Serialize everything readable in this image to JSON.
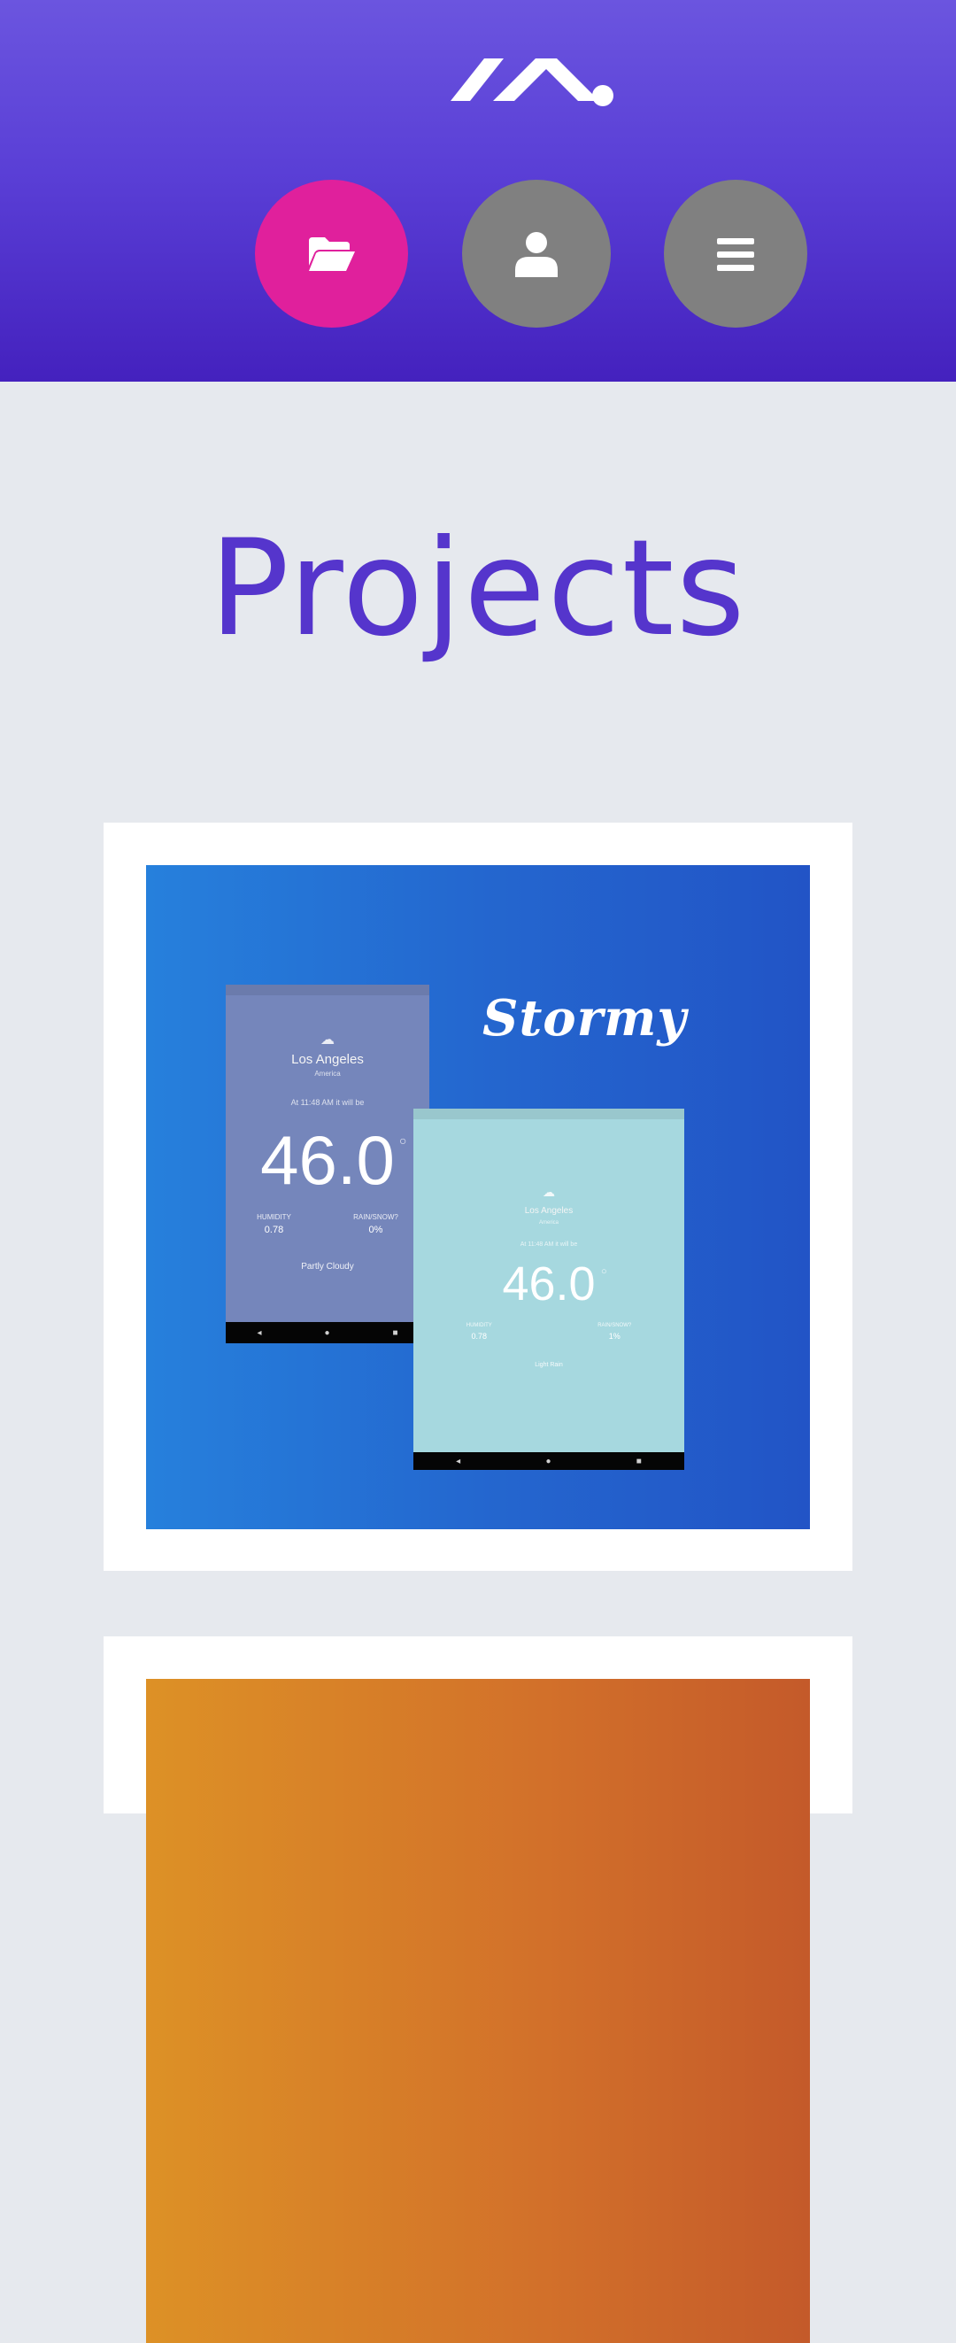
{
  "header": {
    "logo_icon": "logo-mark",
    "nav": [
      {
        "name": "projects",
        "icon": "folder-open-icon",
        "active": true
      },
      {
        "name": "about",
        "icon": "user-icon",
        "active": false
      },
      {
        "name": "menu",
        "icon": "hamburger-menu-icon",
        "active": false
      }
    ],
    "colors": {
      "gradient_top": "#6b55df",
      "gradient_bottom": "#4421be",
      "active": "#e0209c",
      "inactive": "#808080"
    }
  },
  "main": {
    "title": "Projects",
    "title_color": "#5535cc",
    "projects": [
      {
        "brand": "Stormy",
        "phone_a": {
          "city": "Los Angeles",
          "region": "America",
          "time_text": "At 11:48 AM it will be",
          "temperature": "46.0",
          "humidity_label": "HUMIDITY",
          "humidity_value": "0.78",
          "precip_label": "RAIN/SNOW?",
          "precip_value": "0%",
          "summary": "Partly Cloudy"
        },
        "phone_b": {
          "city": "Los Angeles",
          "region": "America",
          "time_text": "At 11:48 AM it will be",
          "temperature": "46.0",
          "humidity_label": "HUMIDITY",
          "humidity_value": "0.78",
          "precip_label": "RAIN/SNOW?",
          "precip_value": "1%",
          "summary": "Light Rain"
        },
        "nav_glyphs": {
          "back": "◂",
          "home": "●",
          "recent": "■"
        }
      },
      {
        "brand": ""
      }
    ]
  }
}
